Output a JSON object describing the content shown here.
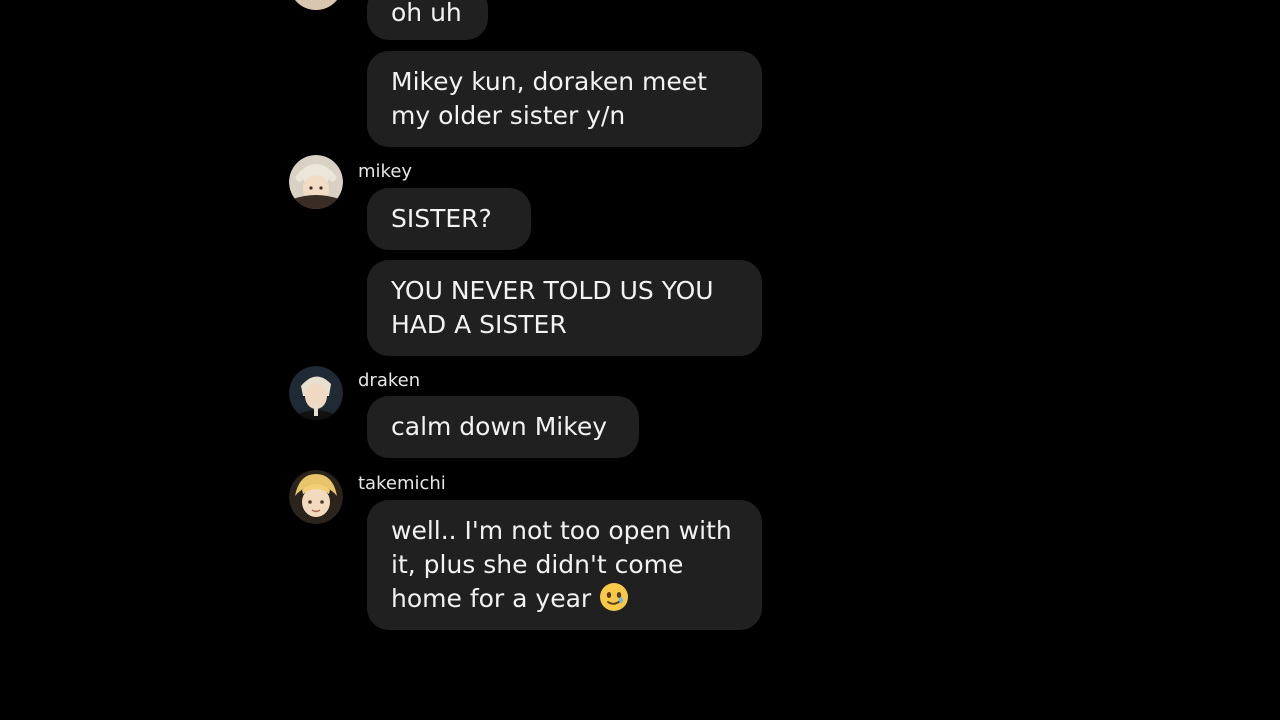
{
  "messages": [
    {
      "text": "oh uh"
    },
    {
      "text": "Mikey kun, doraken meet\nmy older sister y/n"
    },
    {
      "text": "SISTER?"
    },
    {
      "text": "YOU NEVER TOLD US YOU\nHAD A SISTER"
    },
    {
      "text": "calm down Mikey"
    },
    {
      "text": "well.. I'm not too open with\nit, plus she didn't come\nhome for a year"
    }
  ],
  "senders": {
    "mikey": "mikey",
    "draken": "draken",
    "takemichi": "takemichi"
  },
  "emoji": {
    "name": "pleading-smile-emoji"
  },
  "colors": {
    "background": "#000000",
    "bubble": "#202020",
    "text": "#f2f2f2"
  }
}
